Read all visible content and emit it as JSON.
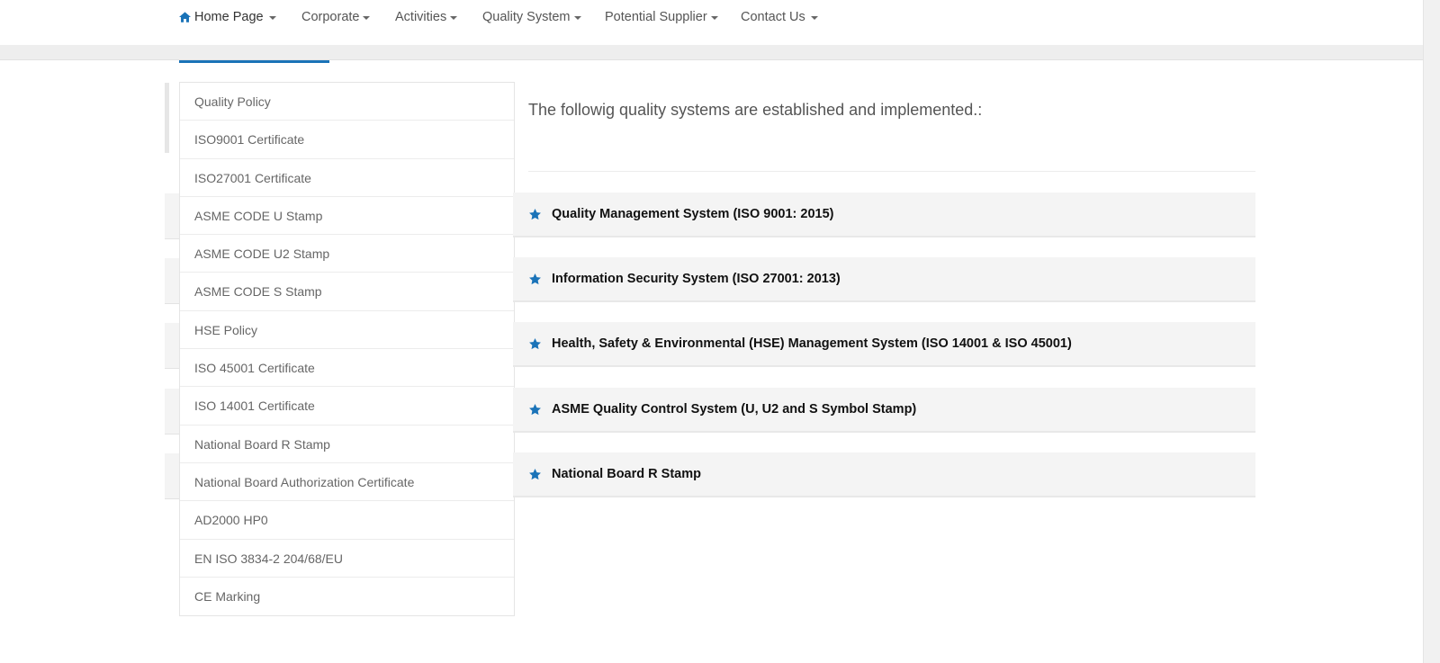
{
  "nav": {
    "items": [
      {
        "label": "Home Page",
        "icon": "home-icon"
      },
      {
        "label": "Corporate"
      },
      {
        "label": "Activities"
      },
      {
        "label": "Quality System"
      },
      {
        "label": "Potential Supplier"
      },
      {
        "label": "Contact Us"
      }
    ]
  },
  "sidebar": {
    "items": [
      {
        "label": "Quality Policy"
      },
      {
        "label": "ISO9001 Certificate"
      },
      {
        "label": "ISO27001 Certificate"
      },
      {
        "label": "ASME CODE U Stamp"
      },
      {
        "label": "ASME CODE U2 Stamp"
      },
      {
        "label": "ASME CODE S Stamp"
      },
      {
        "label": "HSE Policy"
      },
      {
        "label": "ISO 45001 Certificate"
      },
      {
        "label": "ISO 14001 Certificate"
      },
      {
        "label": "National Board R Stamp"
      },
      {
        "label": "National Board Authorization Certificate"
      },
      {
        "label": "AD2000 HP0"
      },
      {
        "label": "EN ISO 3834-2 204/68/EU"
      },
      {
        "label": "CE Marking"
      }
    ]
  },
  "main": {
    "intro": "The followig quality systems are established and implemented.:",
    "panels": [
      {
        "title": "Quality Management System (ISO 9001: 2015)",
        "icon": "star-icon"
      },
      {
        "title": "Information Security System (ISO 27001: 2013)",
        "icon": "star-icon"
      },
      {
        "title": "Health, Safety & Environmental (HSE) Management System (ISO 14001 & ISO 45001)",
        "icon": "star-icon"
      },
      {
        "title": "ASME Quality Control System (U, U2 and S Symbol Stamp)",
        "icon": "star-icon"
      },
      {
        "title": "National Board R Stamp",
        "icon": "star-icon"
      }
    ]
  },
  "colors": {
    "accent": "#1a73b8",
    "panel_bg": "#f4f4f4",
    "nav_band": "#eeeeee"
  }
}
